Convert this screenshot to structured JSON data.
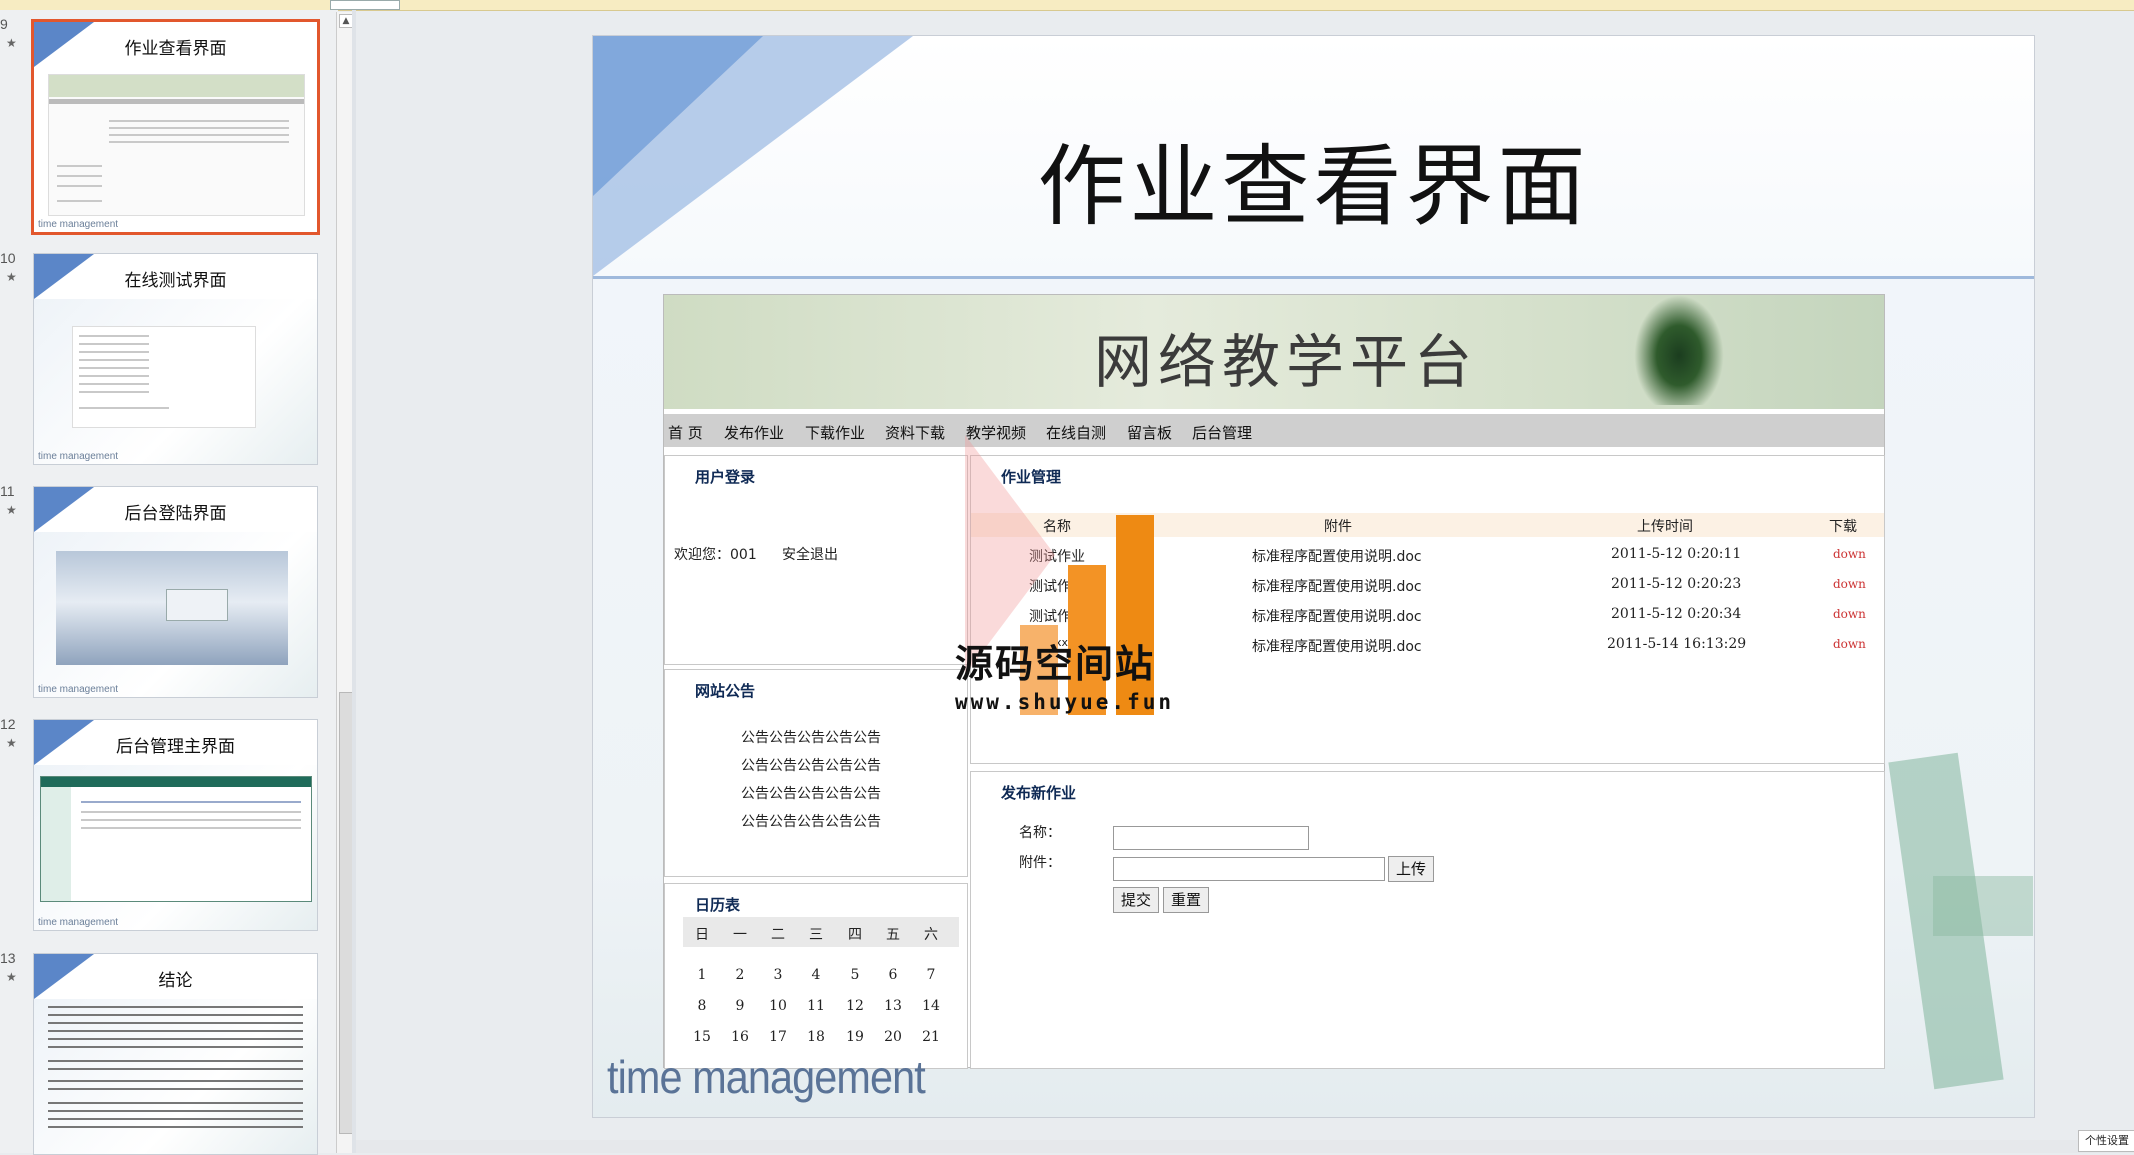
{
  "thumbnails": [
    {
      "num": "9",
      "star": "★",
      "title": "作业查看界面",
      "footer": "time management"
    },
    {
      "num": "10",
      "star": "★",
      "title": "在线测试界面",
      "footer": "time management"
    },
    {
      "num": "11",
      "star": "★",
      "title": "后台登陆界面",
      "footer": "time management"
    },
    {
      "num": "12",
      "star": "★",
      "title": "后台管理主界面",
      "footer": "time management"
    },
    {
      "num": "13",
      "star": "★",
      "title": "结论"
    }
  ],
  "slide": {
    "title": "作业查看界面",
    "footer": "time management"
  },
  "site": {
    "banner": "网络教学平台",
    "nav": [
      "首 页",
      "发布作业",
      "下载作业",
      "资料下载",
      "教学视频",
      "在线自测",
      "留言板",
      "后台管理"
    ],
    "login": {
      "title": "用户登录",
      "welcome": "欢迎您：001",
      "logout": "安全退出"
    },
    "notice": {
      "title": "网站公告",
      "lines": [
        "公告公告公告公告公告",
        "公告公告公告公告公告",
        "公告公告公告公告公告",
        "公告公告公告公告公告"
      ]
    },
    "calendar": {
      "title": "日历表",
      "weekdays": [
        "日",
        "一",
        "二",
        "三",
        "四",
        "五",
        "六"
      ],
      "rows": [
        [
          "1",
          "2",
          "3",
          "4",
          "5",
          "6",
          "7"
        ],
        [
          "8",
          "9",
          "10",
          "11",
          "12",
          "13",
          "14"
        ],
        [
          "15",
          "16",
          "17",
          "18",
          "19",
          "20",
          "21"
        ]
      ]
    },
    "homework": {
      "title": "作业管理",
      "columns": [
        "名称",
        "附件",
        "上传时间",
        "下载"
      ],
      "rows": [
        {
          "name": "测试作业",
          "file": "标准程序配置使用说明.doc",
          "time": "2011-5-12 0:20:11",
          "dl": "down"
        },
        {
          "name": "测试作业",
          "file": "标准程序配置使用说明.doc",
          "time": "2011-5-12 0:20:23",
          "dl": "down"
        },
        {
          "name": "测试作业",
          "file": "标准程序配置使用说明.doc",
          "time": "2011-5-12 0:20:34",
          "dl": "down"
        },
        {
          "name": "xxxxxxxxxx",
          "file": "标准程序配置使用说明.doc",
          "time": "2011-5-14 16:13:29",
          "dl": "down"
        }
      ]
    },
    "publish": {
      "title": "发布新作业",
      "name_label": "名称：",
      "file_label": "附件：",
      "upload": "上传",
      "submit": "提交",
      "reset": "重置"
    }
  },
  "watermark": {
    "title": "源码空间站",
    "url": "www.shuyue.fun"
  },
  "status": {
    "label": "个性设置"
  },
  "colors": {
    "selected_border": "#e2572d",
    "accent_blue": "#5b86c8",
    "watermark_orange": "#f39325"
  }
}
